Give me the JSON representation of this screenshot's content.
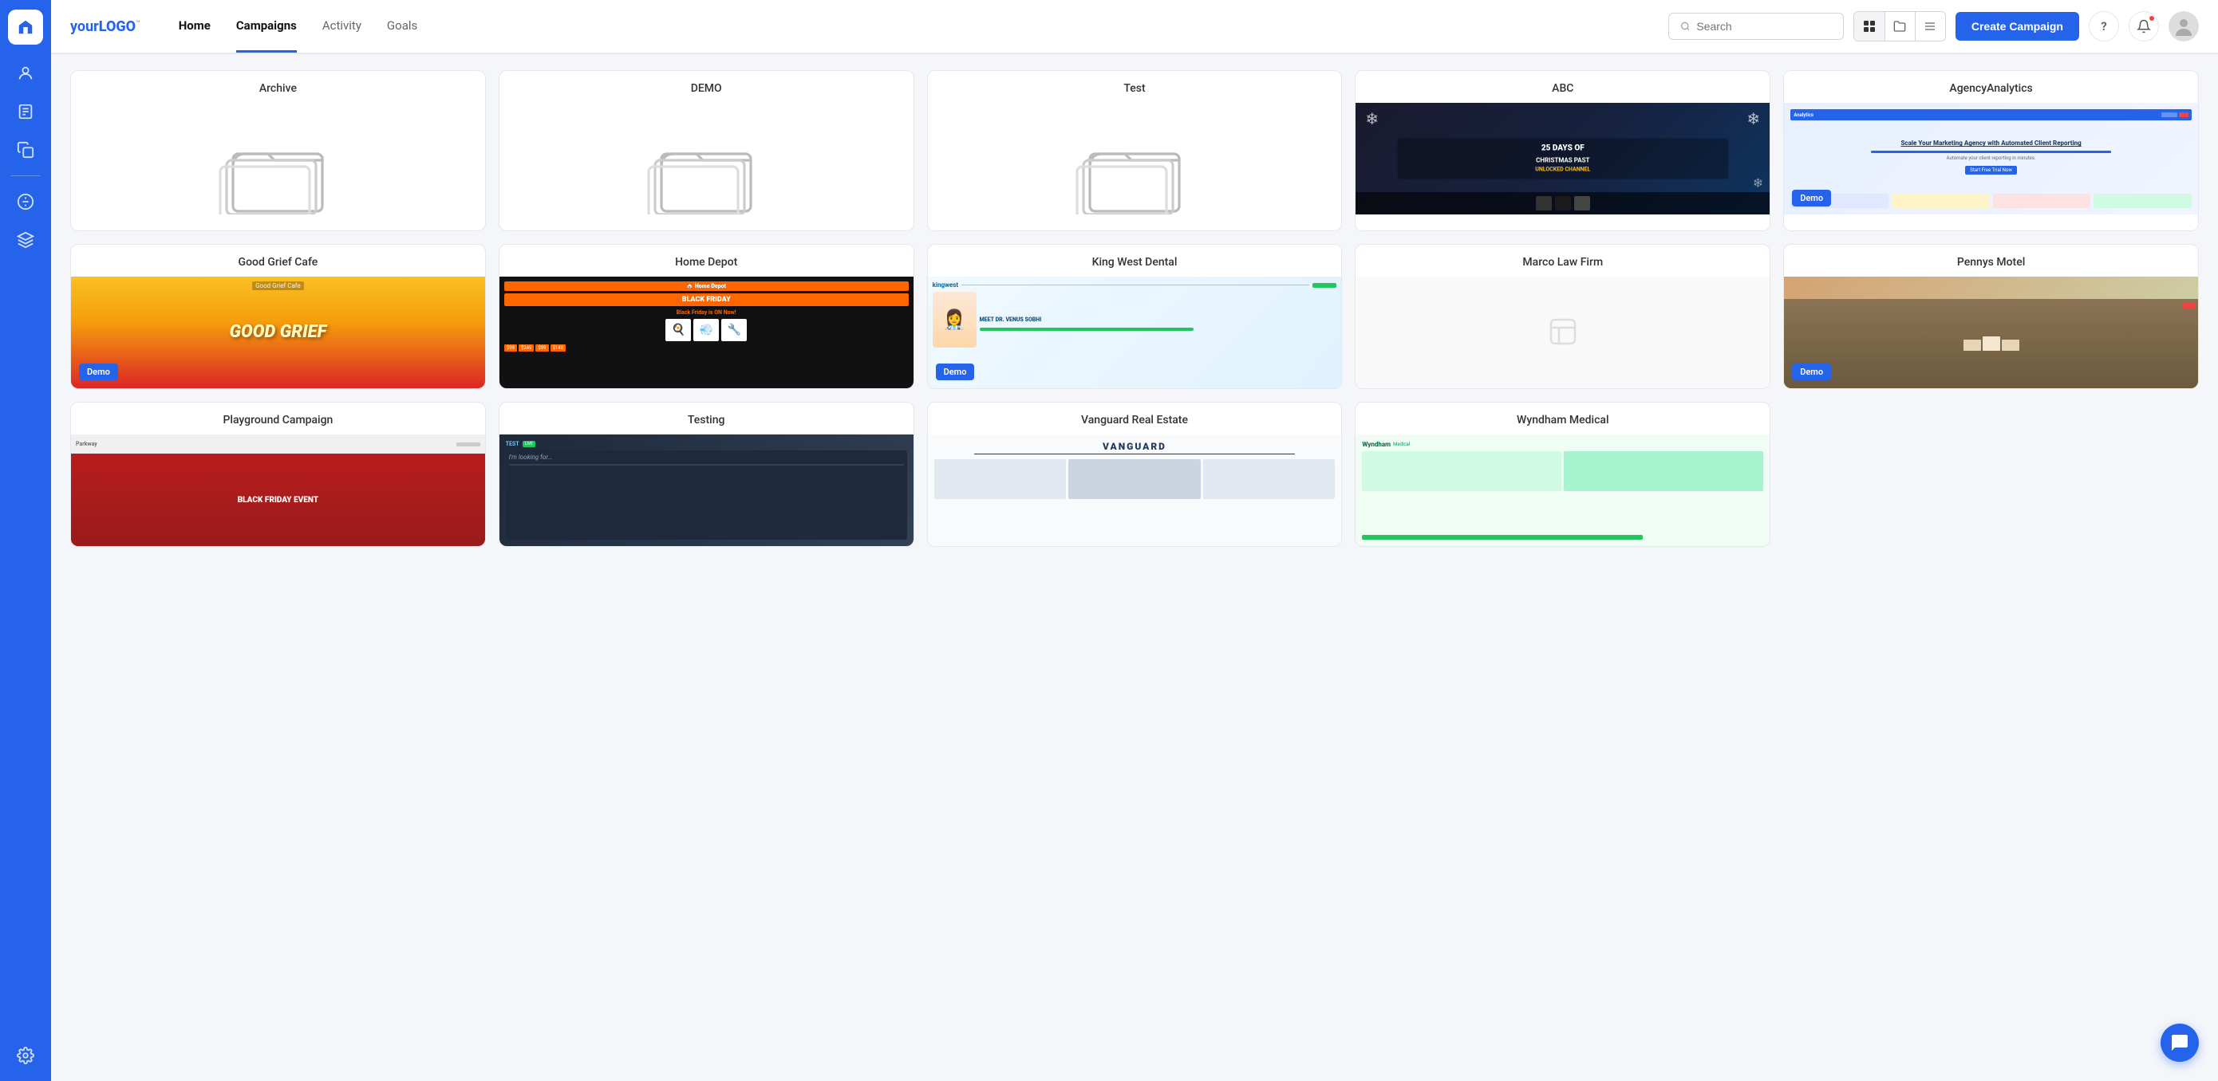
{
  "app": {
    "logo_text": "your",
    "logo_brand": "LOGO",
    "logo_tm": "™"
  },
  "sidebar": {
    "items": [
      {
        "id": "home",
        "icon": "🏠",
        "label": "Home"
      },
      {
        "id": "users",
        "icon": "👤",
        "label": "Users"
      },
      {
        "id": "reports",
        "icon": "📄",
        "label": "Reports"
      },
      {
        "id": "copy",
        "icon": "📋",
        "label": "Copy"
      },
      {
        "id": "billing",
        "icon": "💲",
        "label": "Billing"
      },
      {
        "id": "plugins",
        "icon": "🔌",
        "label": "Plugins"
      },
      {
        "id": "settings",
        "icon": "⚙️",
        "label": "Settings"
      }
    ]
  },
  "topbar": {
    "nav_tabs": [
      {
        "id": "home",
        "label": "Home",
        "active": false
      },
      {
        "id": "campaigns",
        "label": "Campaigns",
        "active": true
      },
      {
        "id": "activity",
        "label": "Activity",
        "active": false
      },
      {
        "id": "goals",
        "label": "Goals",
        "active": false
      }
    ],
    "search_placeholder": "Search",
    "create_campaign_label": "Create Campaign"
  },
  "view_toggle": {
    "options": [
      {
        "id": "grid",
        "icon": "⊞",
        "active": true
      },
      {
        "id": "folder",
        "icon": "🗂",
        "active": false
      },
      {
        "id": "list",
        "icon": "☰",
        "active": false
      }
    ]
  },
  "campaigns": [
    {
      "id": "archive",
      "title": "Archive",
      "type": "folder",
      "demo": false,
      "thumb_type": "folder"
    },
    {
      "id": "demo",
      "title": "DEMO",
      "type": "folder",
      "demo": false,
      "thumb_type": "folder"
    },
    {
      "id": "test",
      "title": "Test",
      "type": "folder",
      "demo": false,
      "thumb_type": "folder"
    },
    {
      "id": "abc",
      "title": "ABC",
      "type": "campaign",
      "demo": false,
      "thumb_type": "abc"
    },
    {
      "id": "agency-analytics",
      "title": "AgencyAnalytics",
      "type": "campaign",
      "demo": true,
      "thumb_type": "agency",
      "thumb_text": "Scale Your Marketing Agency with Automated Client Reporting"
    },
    {
      "id": "good-grief-cafe",
      "title": "Good Grief Cafe",
      "type": "campaign",
      "demo": true,
      "thumb_type": "cafe",
      "thumb_text": "GOOD GRIEF"
    },
    {
      "id": "home-depot",
      "title": "Home Depot",
      "type": "campaign",
      "demo": false,
      "thumb_type": "homedepot"
    },
    {
      "id": "king-west-dental",
      "title": "King West Dental",
      "type": "campaign",
      "demo": true,
      "thumb_type": "dental",
      "thumb_text": "MEET DR. VENUS SOBHI"
    },
    {
      "id": "marco-law-firm",
      "title": "Marco Law Firm",
      "type": "campaign",
      "demo": false,
      "thumb_type": "empty"
    },
    {
      "id": "pennys-motel",
      "title": "Pennys Motel",
      "type": "campaign",
      "demo": true,
      "thumb_type": "pennymotel"
    },
    {
      "id": "playground-campaign",
      "title": "Playground Campaign",
      "type": "campaign",
      "demo": false,
      "thumb_type": "playground",
      "thumb_text": "BLACK FRIDAY EVENT"
    },
    {
      "id": "testing",
      "title": "Testing",
      "type": "campaign",
      "demo": false,
      "thumb_type": "testing",
      "thumb_text": "I'm looking for..."
    },
    {
      "id": "vanguard-real-estate",
      "title": "Vanguard Real Estate",
      "type": "campaign",
      "demo": false,
      "thumb_type": "vanguard",
      "thumb_text": "VANGUARD"
    },
    {
      "id": "wyndham-medical",
      "title": "Wyndham Medical",
      "type": "campaign",
      "demo": false,
      "thumb_type": "wyndham"
    }
  ],
  "chat": {
    "icon": "💬"
  }
}
